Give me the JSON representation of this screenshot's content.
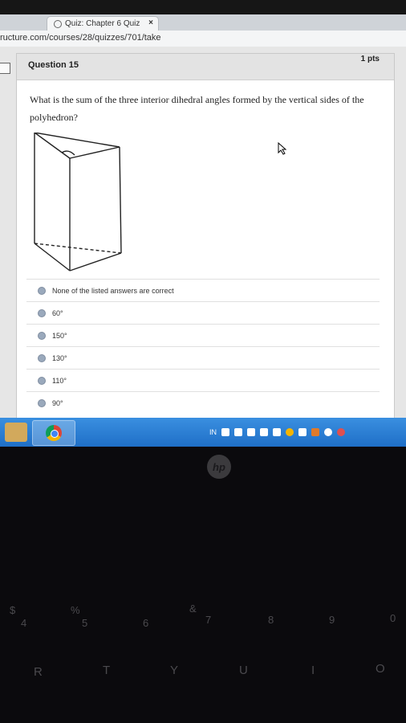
{
  "browser": {
    "tab_title": "Quiz: Chapter 6 Quiz",
    "tab_close": "×",
    "url": "ructure.com/courses/28/quizzes/701/take"
  },
  "question": {
    "title": "Question 15",
    "points": "1 pts",
    "text": "What is the sum of the three interior dihedral angles formed by the vertical sides of the polyhedron?"
  },
  "answers": [
    {
      "label": "None of the listed answers are correct"
    },
    {
      "label": "60°"
    },
    {
      "label": "150°"
    },
    {
      "label": "130°"
    },
    {
      "label": "110°"
    },
    {
      "label": "90°"
    }
  ],
  "taskbar": {
    "lang": "IN",
    "accent": "#2a7fd6"
  },
  "laptop": {
    "logo": "hp",
    "keys_row1": [
      "$",
      "4",
      "%",
      "5",
      "6",
      "&",
      "7",
      "8",
      "9",
      "0"
    ],
    "keys_row2": [
      "R",
      "T",
      "Y",
      "U",
      "I",
      "O"
    ]
  }
}
